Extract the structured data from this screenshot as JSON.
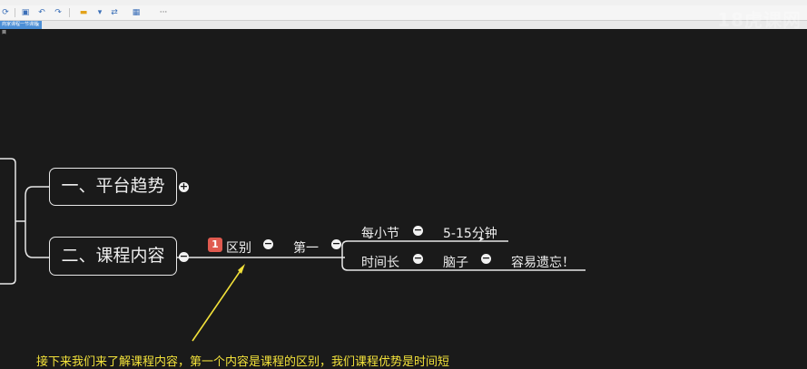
{
  "tab": {
    "title": "商家课程一节课题目",
    "close": "×"
  },
  "watermark": "18虎课网",
  "toolbar": {
    "icons": [
      "refresh-icon",
      "save-icon",
      "undo-icon",
      "redo-icon",
      "insert-topic-icon",
      "link-icon",
      "image-icon",
      "more-icon"
    ],
    "more": "···"
  },
  "mindmap": {
    "branch1": {
      "label": "一、平台趋势",
      "expand": "+"
    },
    "branch2": {
      "label": "二、课程内容",
      "collapse": "−"
    },
    "sub_difference": {
      "badge": "1",
      "label": "区别",
      "collapse": "−"
    },
    "sub_first": {
      "label": "第一",
      "collapse": "−"
    },
    "leaf_per_section": {
      "label": "每小节",
      "collapse": "−"
    },
    "leaf_minutes": {
      "label": "5-15分钟"
    },
    "leaf_short_time": {
      "label": "时间长",
      "collapse": "−"
    },
    "leaf_brain": {
      "label": "脑子",
      "collapse": "−"
    },
    "leaf_forget": {
      "label": "容易遗忘！"
    }
  },
  "subtitle": "接下来我们来了解课程内容，第一个内容是课程的区别，我们课程优势是时间短",
  "colors": {
    "background": "#1a1a1a",
    "arrow": "#f2e13a",
    "badge": "#e05a4f",
    "tab": "#4c8fd6"
  }
}
